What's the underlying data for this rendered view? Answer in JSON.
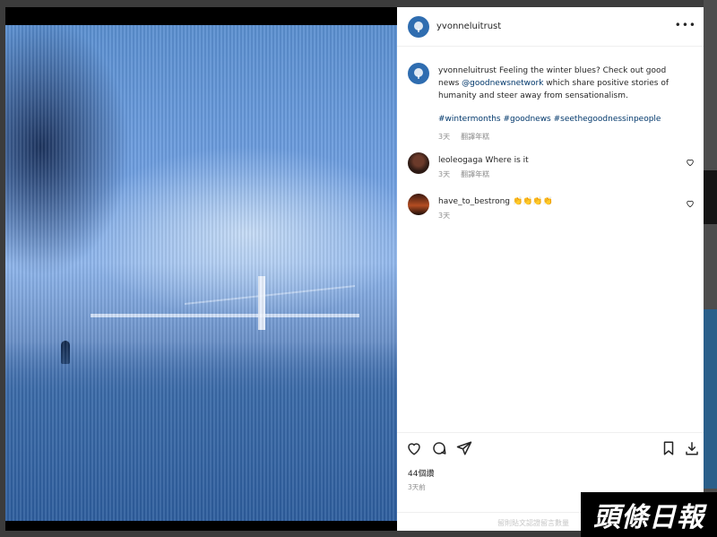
{
  "post": {
    "author": "yvonneluitrust",
    "more_label": "•••"
  },
  "caption": {
    "username": "yvonneluitrust",
    "text_1": "Feeling the winter blues? Check out good news ",
    "mention": "@goodnewsnetwork",
    "text_2": " which share positive stories of humanity and steer away from sensationalism.",
    "hashtags": "#wintermonths #goodnews #seethegoodnessinpeople",
    "time": "3天",
    "translate": "翻譯年糕"
  },
  "comments": [
    {
      "username": "leoleogaga",
      "text": "Where is it",
      "time": "3天",
      "translate": "翻譯年糕"
    },
    {
      "username": "have_to_bestrong",
      "text": "👏👏👏👏",
      "time": "3天"
    }
  ],
  "stats": {
    "likes": "44個讚",
    "date": "3天前"
  },
  "comment_input": {
    "placeholder": "留則貼文認證留言數量"
  },
  "watermark": {
    "text": "頭條日報"
  },
  "colors": {
    "link": "#00376b",
    "muted": "#8e8e8e",
    "text": "#262626"
  }
}
